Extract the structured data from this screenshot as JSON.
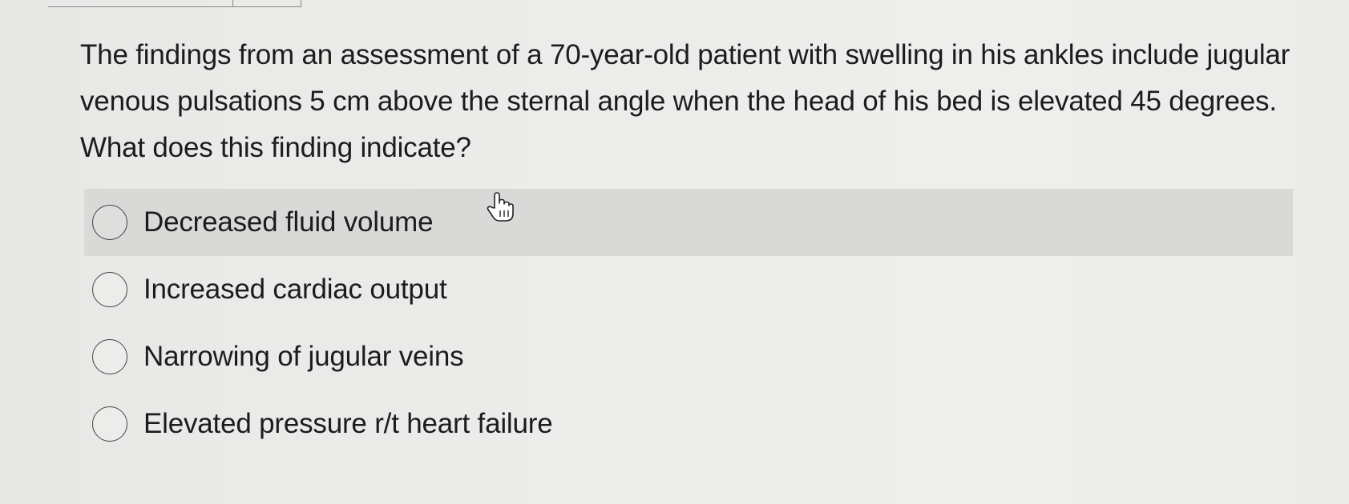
{
  "question": {
    "text": "The findings from an assessment of a 70-year-old patient with swelling in his ankles include jugular venous pulsations 5 cm above the sternal angle when the head of his bed is elevated 45 degrees. What does this finding indicate?"
  },
  "options": [
    {
      "label": "Decreased fluid volume",
      "highlighted": true
    },
    {
      "label": "Increased cardiac output",
      "highlighted": false
    },
    {
      "label": "Narrowing of jugular veins",
      "highlighted": false
    },
    {
      "label": "Elevated pressure r/t heart failure",
      "highlighted": false
    }
  ],
  "cursor": {
    "icon": "hand-pointer-icon"
  },
  "colors": {
    "background": "#ececea",
    "highlight": "#d9d9d7",
    "text": "#1c1c1c"
  }
}
